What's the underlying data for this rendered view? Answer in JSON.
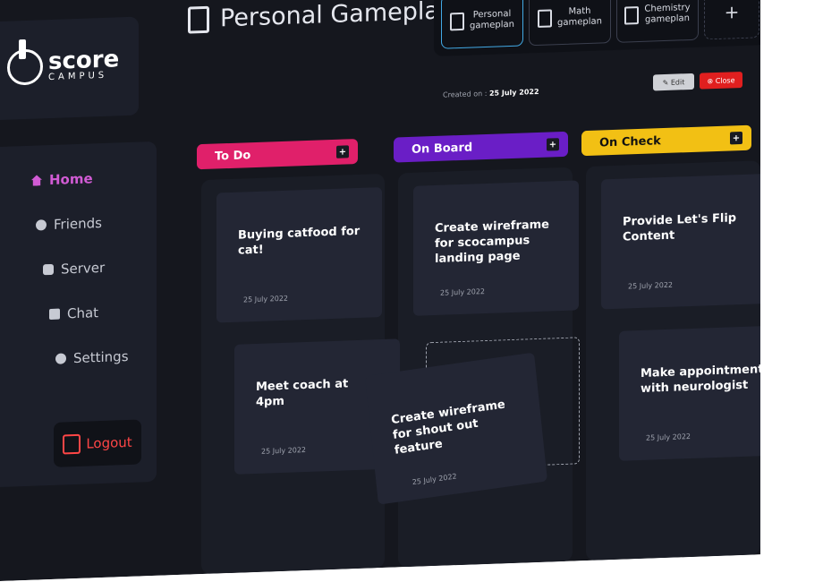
{
  "brand": {
    "name": "score",
    "sub": "CAMPUS"
  },
  "page_title": "Personal Gameplan",
  "tabs": [
    {
      "label": "Personal\ngameplan"
    },
    {
      "label": "Math\ngameplan"
    },
    {
      "label": "Chemistry\ngameplan"
    },
    {
      "label": "+"
    }
  ],
  "meta": {
    "created_label": "Created on :",
    "created_date": "25 July 2022"
  },
  "actions": {
    "edit": "✎ Edit",
    "close": "⊗ Close"
  },
  "nav": [
    {
      "label": "Home"
    },
    {
      "label": "Friends"
    },
    {
      "label": "Server"
    },
    {
      "label": "Chat"
    },
    {
      "label": "Settings"
    }
  ],
  "logout": "Logout",
  "columns": [
    {
      "title": "To Do",
      "color": "#e0206a"
    },
    {
      "title": "On Board",
      "color": "#6a1ec6"
    },
    {
      "title": "On Check",
      "color": "#f2c014"
    }
  ],
  "cards": [
    {
      "title": "Buying catfood for cat!",
      "date": "25 July 2022"
    },
    {
      "title": "Meet coach at 4pm",
      "date": "25 July 2022"
    },
    {
      "title": "Create wireframe for scocampus landing page",
      "date": "25 July 2022"
    },
    {
      "title": "Provide Let's Flip Content",
      "date": "25 July 2022"
    },
    {
      "title": "Make appointment with neurologist",
      "date": "25 July 2022"
    },
    {
      "title": "Create wireframe for shout out feature",
      "date": "25 July 2022"
    }
  ]
}
